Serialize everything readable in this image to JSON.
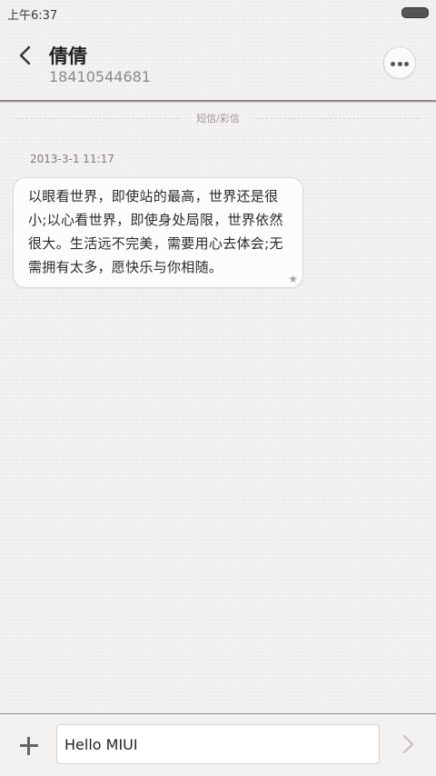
{
  "status_bar": {
    "time": "上午6:37",
    "battery_icon": "battery-icon"
  },
  "header": {
    "back_icon": "chevron-left-icon",
    "contact_name": "倩倩",
    "contact_number": "18410544681",
    "more_icon": "more-horizontal-icon"
  },
  "thread": {
    "type_label": "短信/彩信",
    "messages": [
      {
        "timestamp": "2013-3-1 11:17",
        "text": "以眼看世界，即使站的最高，世界还是很小;以心看世界，即使身处局限，世界依然很大。生活远不完美，需要用心去体会;无需拥有太多，愿快乐与你相随。",
        "star_icon": "star-icon",
        "star_glyph": "★"
      }
    ]
  },
  "composer": {
    "attach_icon": "plus-icon",
    "input_value": "Hello MIUI",
    "send_icon": "send-chevron-icon"
  },
  "colors": {
    "background": "#f4f2f0",
    "bubble": "#fcfcfb",
    "divider": "#8f8c89",
    "secondary_text": "#8a8a8a"
  }
}
